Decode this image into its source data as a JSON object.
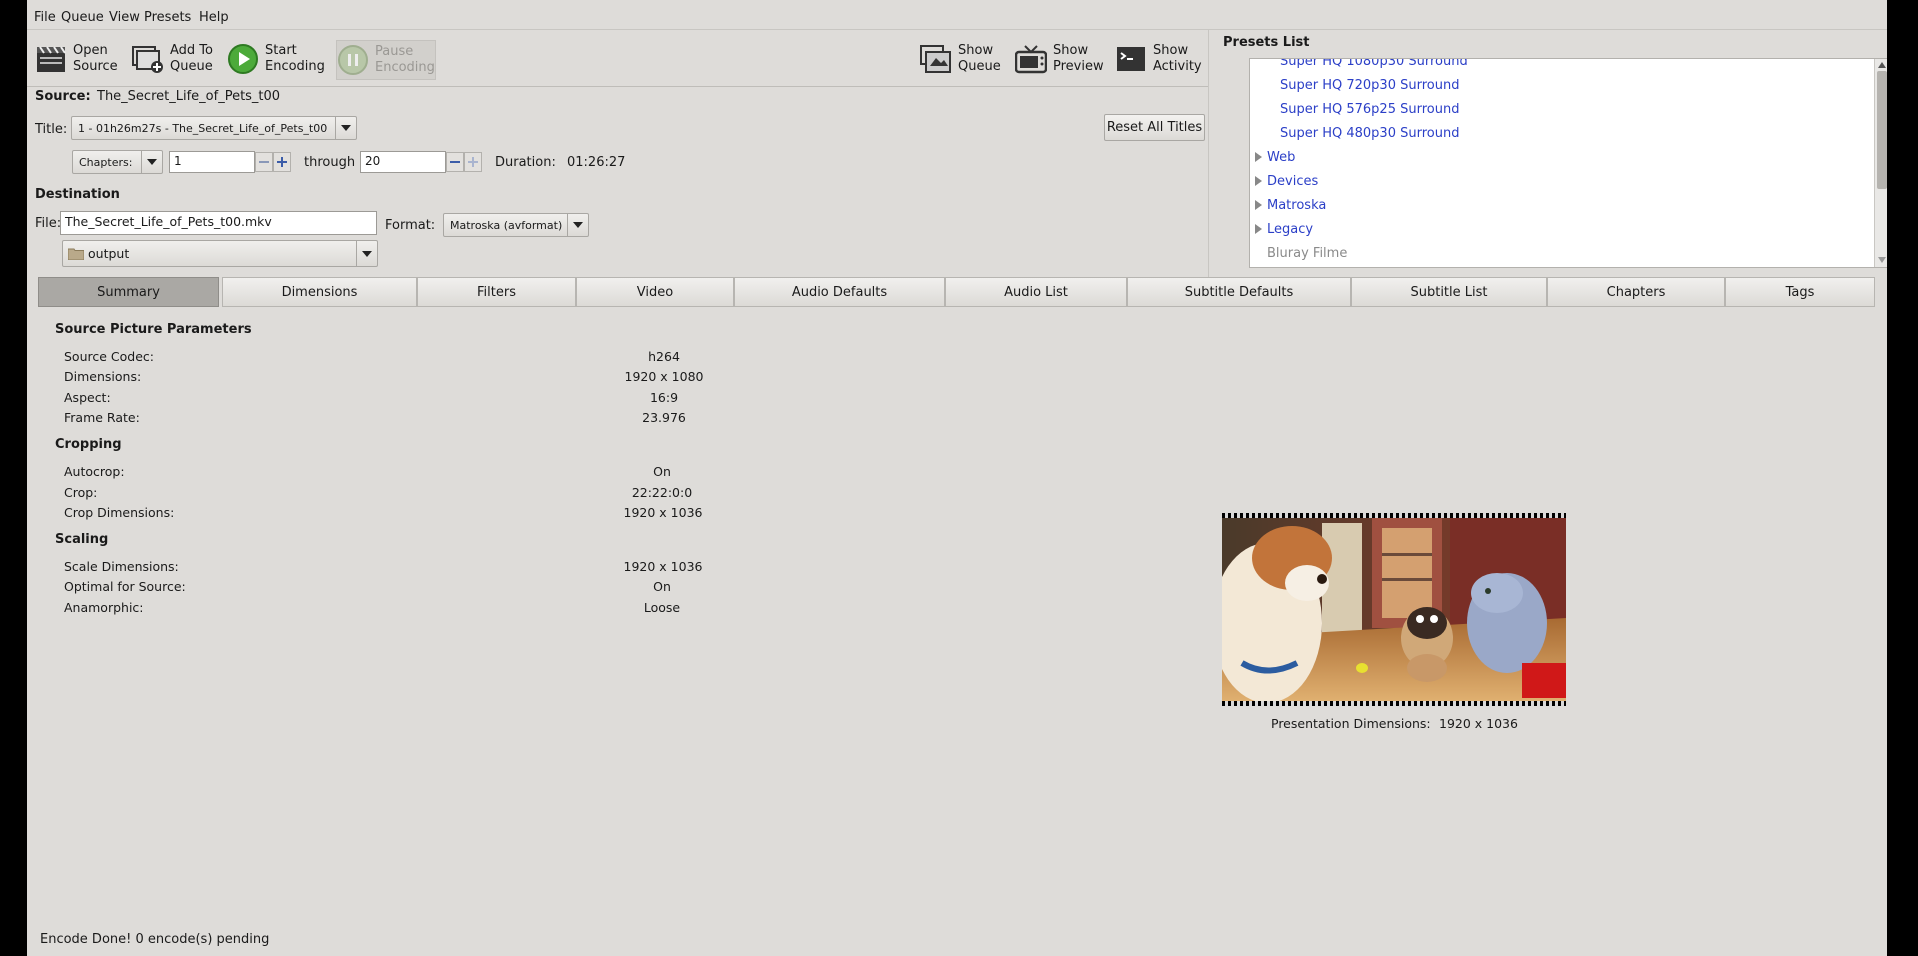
{
  "menu": [
    "File",
    "Queue",
    "View",
    "Presets",
    "Help"
  ],
  "toolbar": {
    "open_source": "Open\nSource",
    "add_to_queue": "Add To\nQueue",
    "start_encoding": "Start\nEncoding",
    "pause_encoding": "Pause\nEncoding",
    "show_queue": "Show\nQueue",
    "show_preview": "Show\nPreview",
    "show_activity": "Show\nActivity"
  },
  "source": {
    "label": "Source:",
    "value": "The_Secret_Life_of_Pets_t00"
  },
  "title_row": {
    "label": "Title:",
    "value": "1 - 01h26m27s - The_Secret_Life_of_Pets_t00",
    "reset_button": "Reset All Titles"
  },
  "range": {
    "mode": "Chapters:",
    "start": "1",
    "through_label": "through",
    "end": "20",
    "duration_label": "Duration:",
    "duration_value": "01:26:27"
  },
  "destination": {
    "heading": "Destination",
    "file_label": "File:",
    "file_value": "The_Secret_Life_of_Pets_t00.mkv",
    "format_label": "Format:",
    "format_value": "Matroska (avformat)",
    "folder": "output"
  },
  "presets": {
    "heading": "Presets List",
    "items": [
      {
        "label": "Super HQ 1080p30 Surround",
        "kind": "preset"
      },
      {
        "label": "Super HQ 720p30 Surround",
        "kind": "preset"
      },
      {
        "label": "Super HQ 576p25 Surround",
        "kind": "preset"
      },
      {
        "label": "Super HQ 480p30 Surround",
        "kind": "preset"
      },
      {
        "label": "Web",
        "kind": "group"
      },
      {
        "label": "Devices",
        "kind": "group"
      },
      {
        "label": "Matroska",
        "kind": "group"
      },
      {
        "label": "Legacy",
        "kind": "group"
      },
      {
        "label": "Bluray Filme",
        "kind": "custom"
      }
    ]
  },
  "tabs": [
    "Summary",
    "Dimensions",
    "Filters",
    "Video",
    "Audio Defaults",
    "Audio List",
    "Subtitle Defaults",
    "Subtitle List",
    "Chapters",
    "Tags"
  ],
  "summary": {
    "source_params_title": "Source Picture Parameters",
    "source_codec_label": "Source Codec:",
    "source_codec_value": "h264",
    "dimensions_label": "Dimensions:",
    "dimensions_value": "1920 x 1080",
    "aspect_label": "Aspect:",
    "aspect_value": "16:9",
    "frame_rate_label": "Frame Rate:",
    "frame_rate_value": "23.976",
    "cropping_title": "Cropping",
    "autocrop_label": "Autocrop:",
    "autocrop_value": "On",
    "crop_label": "Crop:",
    "crop_value": "22:22:0:0",
    "crop_dim_label": "Crop Dimensions:",
    "crop_dim_value": "1920 x 1036",
    "scaling_title": "Scaling",
    "scale_dim_label": "Scale Dimensions:",
    "scale_dim_value": "1920 x 1036",
    "optimal_label": "Optimal for Source:",
    "optimal_value": "On",
    "anamorphic_label": "Anamorphic:",
    "anamorphic_value": "Loose",
    "presentation_label": "Presentation Dimensions:",
    "presentation_value": "1920 x 1036"
  },
  "status": "Encode Done!  0 encode(s) pending",
  "colors": {
    "window_bg": "#dedcd9",
    "preset_link": "#2b3fc7",
    "active_tab": "#aaa8a4"
  }
}
